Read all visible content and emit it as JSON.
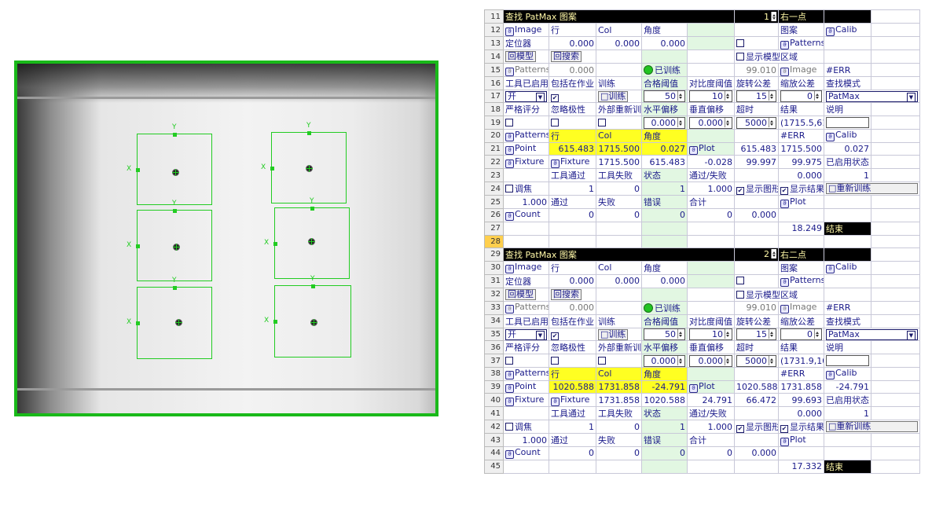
{
  "image_view": {
    "roi": {
      "y_label": "Y",
      "x_label": "X"
    }
  },
  "blocks": [
    {
      "rows": {
        "r11": {
          "n": "11",
          "title": "查找 PatMax 图案",
          "index": "1",
          "name": "右一点"
        },
        "r12": {
          "n": "12",
          "a": "Image",
          "b": "行",
          "c": "Col",
          "d": "角度",
          "g": "图案",
          "h": "Calib"
        },
        "r13": {
          "n": "13",
          "a": "定位器",
          "b": "0.000",
          "c": "0.000",
          "d": "0.000",
          "g": "Patterns"
        },
        "r14": {
          "n": "14",
          "a": "模型",
          "b": "搜索",
          "f": "显示模型区域"
        },
        "r15": {
          "n": "15",
          "a": "Patterns",
          "b": "0.000",
          "d": "已训练",
          "f": "99.010",
          "g": "Image",
          "h": "#ERR"
        },
        "r16": {
          "n": "16",
          "a": "工具已启用",
          "b": "包括在作业",
          "c": "训练",
          "d": "合格阈值",
          "e": "对比度阈值",
          "f": "旋转公差",
          "g": "缩放公差",
          "h": "查找模式"
        },
        "r17": {
          "n": "17",
          "a": "开",
          "c": "训练",
          "d": "50",
          "e": "10",
          "f": "15",
          "g": "0",
          "h": "PatMax"
        },
        "r18": {
          "n": "18",
          "a": "严格评分",
          "b": "忽略极性",
          "c": "外部重新训练",
          "d": "水平偏移",
          "e": "垂直偏移",
          "f": "超时",
          "g": "结果",
          "h": "说明"
        },
        "r19": {
          "n": "19",
          "d": "0.000",
          "e": "0.000",
          "f": "5000",
          "g": "(1715.5,61:"
        },
        "r20": {
          "n": "20",
          "a": "Patterns",
          "b": "行",
          "c": "Col",
          "d": "角度",
          "g": "#ERR",
          "h": "Calib"
        },
        "r21": {
          "n": "21",
          "a": "Point",
          "b": "615.483",
          "c": "1715.500",
          "d": "0.027",
          "e": "Plot",
          "f": "615.483",
          "g": "1715.500",
          "h": "0.027"
        },
        "r22": {
          "n": "22",
          "a": "Fixture",
          "b": "Fixture",
          "c": "1715.500",
          "d": "615.483",
          "e": "-0.028",
          "f": "99.997",
          "g": "99.975",
          "h": "已启用状态"
        },
        "r23": {
          "n": "23",
          "b": "工具通过",
          "c": "工具失败",
          "d": "状态",
          "e": "通过/失败",
          "g": "0.000",
          "h": "1"
        },
        "r24": {
          "n": "24",
          "a": "调焦",
          "b": "1",
          "c": "0",
          "d": "1",
          "e": "1.000",
          "f": "显示图形",
          "g": "显示结果",
          "h": "重新训练"
        },
        "r25": {
          "n": "25",
          "a": "1.000",
          "b": "通过",
          "c": "失败",
          "d": "错误",
          "e": "合计",
          "g": "Plot"
        },
        "r26": {
          "n": "26",
          "a": "Count",
          "b": "0",
          "c": "0",
          "d": "0",
          "e": "0",
          "f": "0.000"
        },
        "r27": {
          "n": "27",
          "g": "18.249",
          "h": "结束"
        }
      }
    },
    {
      "rows": {
        "r29": {
          "n": "29",
          "title": "查找 PatMax 图案",
          "index": "2",
          "name": "右二点"
        },
        "r30": {
          "n": "30",
          "a": "Image",
          "b": "行",
          "c": "Col",
          "d": "角度",
          "g": "图案",
          "h": "Calib"
        },
        "r31": {
          "n": "31",
          "a": "定位器",
          "b": "0.000",
          "c": "0.000",
          "d": "0.000",
          "g": "Patterns"
        },
        "r32": {
          "n": "32",
          "a": "模型",
          "b": "搜索",
          "f": "显示模型区域"
        },
        "r33": {
          "n": "33",
          "a": "Patterns",
          "b": "0.000",
          "d": "已训练",
          "f": "99.010",
          "g": "Image",
          "h": "#ERR"
        },
        "r34": {
          "n": "34",
          "a": "工具已启用",
          "b": "包括在作业",
          "c": "训练",
          "d": "合格阈值",
          "e": "对比度阈值",
          "f": "旋转公差",
          "g": "缩放公差",
          "h": "查找模式"
        },
        "r35": {
          "n": "35",
          "a": "开",
          "c": "训练",
          "d": "50",
          "e": "10",
          "f": "15",
          "g": "0",
          "h": "PatMax"
        },
        "r36": {
          "n": "36",
          "a": "严格评分",
          "b": "忽略极性",
          "c": "外部重新训练",
          "d": "水平偏移",
          "e": "垂直偏移",
          "f": "超时",
          "g": "结果",
          "h": "说明"
        },
        "r37": {
          "n": "37",
          "d": "0.000",
          "e": "0.000",
          "f": "5000",
          "g": "(1731.9,10:"
        },
        "r38": {
          "n": "38",
          "a": "Patterns",
          "b": "行",
          "c": "Col",
          "d": "角度",
          "g": "#ERR",
          "h": "Calib"
        },
        "r39": {
          "n": "39",
          "a": "Point",
          "b": "1020.588",
          "c": "1731.858",
          "d": "-24.791",
          "e": "Plot",
          "f": "1020.588",
          "g": "1731.858",
          "h": "-24.791"
        },
        "r40": {
          "n": "40",
          "a": "Fixture",
          "b": "Fixture",
          "c": "1731.858",
          "d": "1020.588",
          "e": "24.791",
          "f": "66.472",
          "g": "99.693",
          "h": "已启用状态"
        },
        "r41": {
          "n": "41",
          "b": "工具通过",
          "c": "工具失败",
          "d": "状态",
          "e": "通过/失败",
          "g": "0.000",
          "h": "1"
        },
        "r42": {
          "n": "42",
          "a": "调焦",
          "b": "1",
          "c": "0",
          "d": "1",
          "e": "1.000",
          "f": "显示图形",
          "g": "显示结果",
          "h": "重新训练"
        },
        "r43": {
          "n": "43",
          "a": "1.000",
          "b": "通过",
          "c": "失败",
          "d": "错误",
          "e": "合计",
          "g": "Plot"
        },
        "r44": {
          "n": "44",
          "a": "Count",
          "b": "0",
          "c": "0",
          "d": "0",
          "e": "0",
          "f": "0.000"
        },
        "r45": {
          "n": "45",
          "g": "17.332",
          "h": "结束"
        }
      }
    }
  ],
  "row28": {
    "n": "28"
  },
  "icons": {
    "fx": "fx-icon",
    "check": "✔",
    "spin": "spin-button-icon",
    "dropdown": "dropdown-icon"
  },
  "colors": {
    "roi_green": "#22cc22",
    "highlight_yellow": "#ffff22",
    "header_black": "#000000",
    "current_row_orange": "#ffcf4d"
  }
}
